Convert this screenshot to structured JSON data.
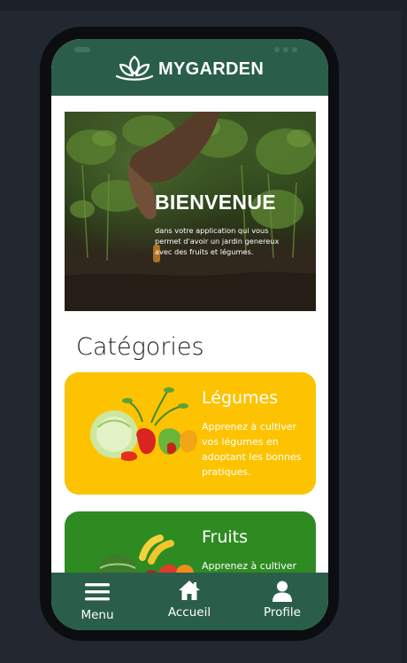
{
  "app": {
    "brand": "MYGARDEN"
  },
  "hero": {
    "title": "BIENVENUE",
    "text": "dans votre application qui vous permet d'avoir un jardin genereux avec des fruits et légumes."
  },
  "categories": {
    "heading": "Catégories",
    "items": [
      {
        "title": "Légumes",
        "text": "Apprenez à cultiver vos légumes en adoptant les bonnes pratiques."
      },
      {
        "title": "Fruits",
        "text": "Apprenez à cultiver"
      }
    ]
  },
  "nav": {
    "items": [
      {
        "label": "Menu",
        "icon": "hamburger-icon"
      },
      {
        "label": "Accueil",
        "icon": "home-icon"
      },
      {
        "label": "Profile",
        "icon": "user-icon"
      }
    ]
  },
  "colors": {
    "primary": "#2a5e4a",
    "legumes_card": "#fdc300",
    "fruits_card": "#2e8b22"
  }
}
